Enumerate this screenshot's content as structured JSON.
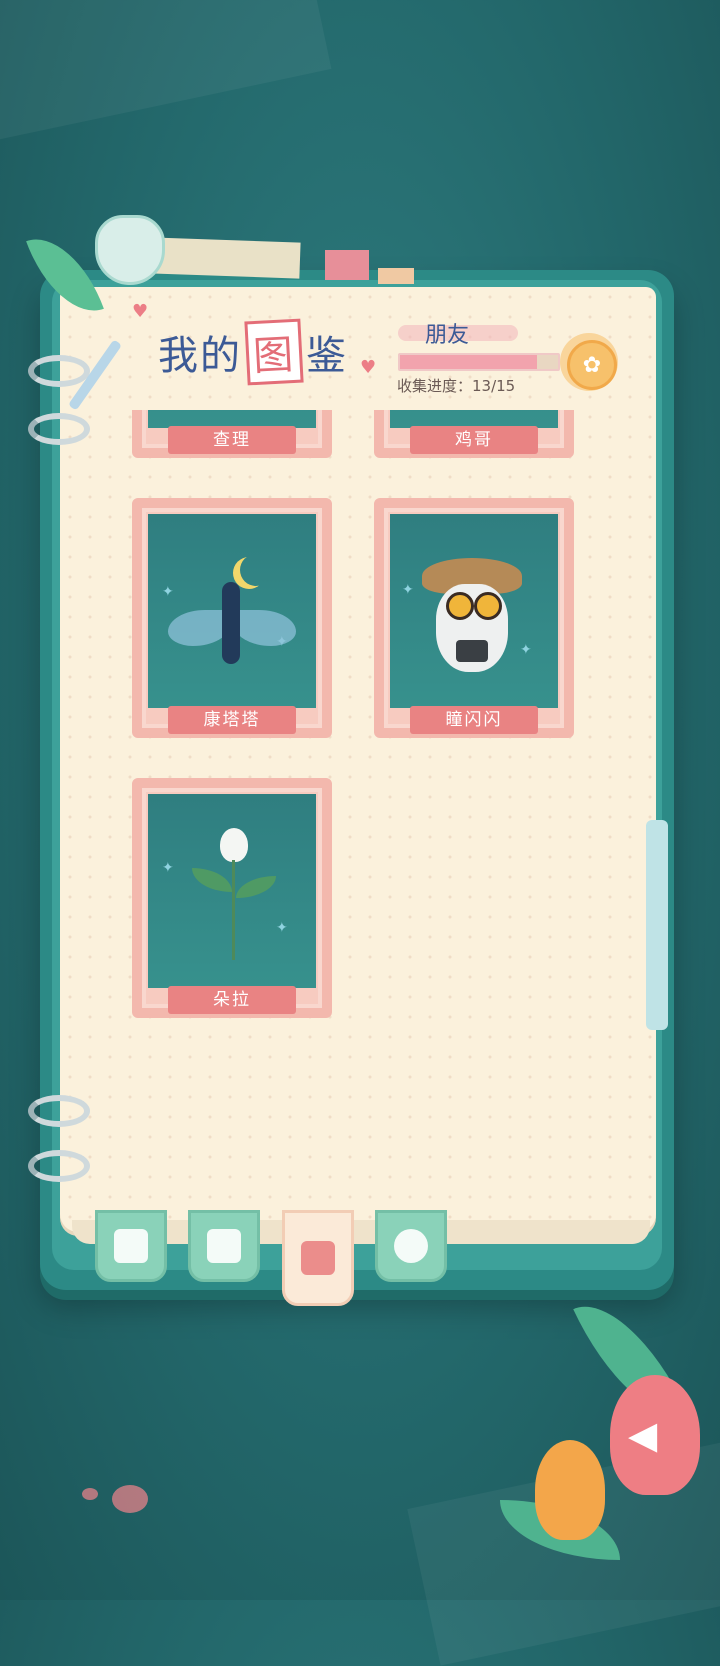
{
  "header": {
    "title_part1": "我的",
    "title_part2": "图",
    "title_part3": "鉴",
    "category": "朋友",
    "progress_text": "收集进度：13/15",
    "progress_fraction": 0.867
  },
  "cards": [
    {
      "name": "查理",
      "icon": "character-charlie"
    },
    {
      "name": "鸡哥",
      "icon": "character-chicken"
    },
    {
      "name": "康塔塔",
      "icon": "moth-fairy-icon"
    },
    {
      "name": "瞳闪闪",
      "icon": "owl-explorer-icon"
    },
    {
      "name": "朵拉",
      "icon": "tulip-spirit-icon"
    }
  ],
  "tabs": [
    {
      "icon": "notes-pencil-icon",
      "active": false
    },
    {
      "icon": "photo-album-icon",
      "active": false
    },
    {
      "icon": "star-book-icon",
      "active": true
    },
    {
      "icon": "flower-icon",
      "active": false
    }
  ],
  "colors": {
    "background": "#23686b",
    "page": "#fbf1dc",
    "card_frame": "#f3b8ad",
    "label": "#e98383",
    "tab": "#8ad2b9",
    "title_blue": "#3c5a96"
  }
}
